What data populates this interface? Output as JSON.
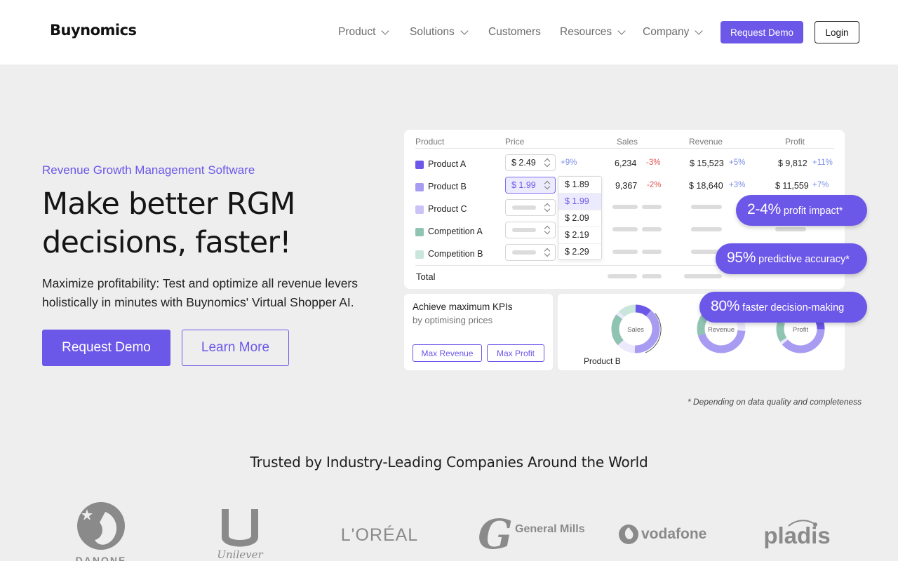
{
  "header": {
    "logo": "Buynomics",
    "nav": [
      {
        "label": "Product",
        "has_dropdown": true
      },
      {
        "label": "Solutions",
        "has_dropdown": true
      },
      {
        "label": "Customers",
        "has_dropdown": false
      },
      {
        "label": "Resources",
        "has_dropdown": true
      },
      {
        "label": "Company",
        "has_dropdown": true
      }
    ],
    "request_demo": "Request Demo",
    "login": "Login"
  },
  "hero": {
    "eyebrow": "Revenue Growth Management Software",
    "title": "Make better RGM decisions, faster!",
    "subtitle": "Maximize profitability: Test and optimize all revenue levers holistically in minutes with Buynomics' Virtual Shopper AI.",
    "primary_cta": "Request Demo",
    "secondary_cta": "Learn More"
  },
  "mockup": {
    "columns": [
      "Product",
      "Price",
      "Sales",
      "Revenue",
      "Profit"
    ],
    "rows": [
      {
        "name": "Product A",
        "price": "$ 2.49",
        "price_change": "+9%",
        "sales": "6,234",
        "sales_change": "-3%",
        "revenue": "$ 15,523",
        "revenue_change": "+5%",
        "profit": "$ 9,812",
        "profit_change": "+11%",
        "color": "#6b57e8"
      },
      {
        "name": "Product B",
        "price": "$ 1.99",
        "price_change": "",
        "sales": "9,367",
        "sales_change": "-2%",
        "revenue": "$ 18,640",
        "revenue_change": "+3%",
        "profit": "$ 11,559",
        "profit_change": "+7%",
        "color": "#a89cf2"
      },
      {
        "name": "Product C",
        "color": "#cbc3f7"
      },
      {
        "name": "Competition A",
        "color": "#8fc4b3"
      },
      {
        "name": "Competition B",
        "color": "#c9e6dc"
      }
    ],
    "total_label": "Total",
    "price_options": [
      "$ 1.89",
      "$ 1.99",
      "$ 2.09",
      "$ 2.19",
      "$ 2.29"
    ],
    "selected_price": "$ 1.99",
    "kpi_title": "Achieve maximum KPIs",
    "kpi_subtitle": "by optimising prices",
    "kpi_buttons": [
      "Max Revenue",
      "Max Profit"
    ],
    "donut_labels": [
      "Sales",
      "Revenue",
      "Profit"
    ],
    "donut_pointer_label": "Product B"
  },
  "stats": [
    {
      "value": "2-4%",
      "label": "profit impact*"
    },
    {
      "value": "95%",
      "label": "predictive accuracy*"
    },
    {
      "value": "80%",
      "label": "faster decision-making"
    }
  ],
  "footnote": "* Depending on data quality and completeness",
  "trusted": {
    "heading": "Trusted by Industry-Leading Companies Around the World",
    "logos": [
      "DANONE",
      "Unilever",
      "L'ORÉAL",
      "General Mills",
      "vodafone",
      "pladis"
    ]
  },
  "colors": {
    "accent": "#6b57e8",
    "positive": "#7d8ee8",
    "negative": "#e05555",
    "teal": "#8fc4b3"
  }
}
